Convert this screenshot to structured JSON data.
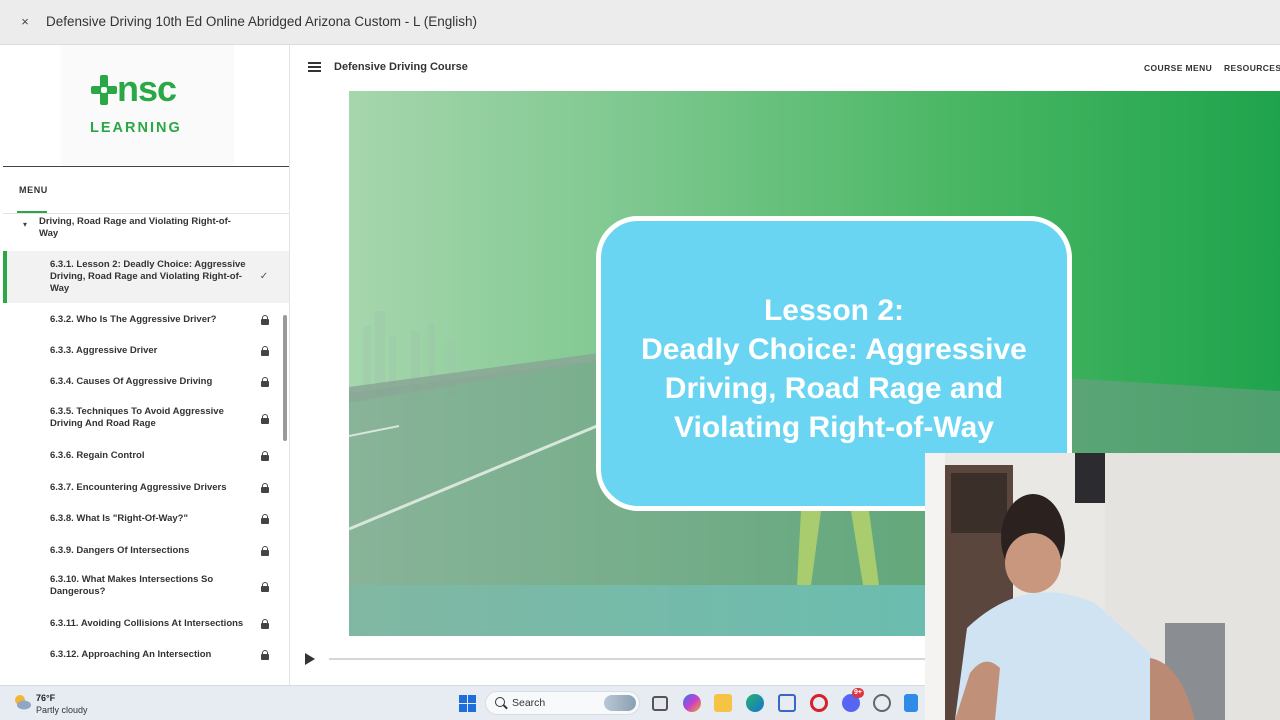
{
  "window": {
    "title": "Defensive Driving 10th Ed Online Abridged Arizona Custom - L (English)",
    "close_glyph": "×"
  },
  "brand": {
    "logo_word": "nsc",
    "logo_sub": "LEARNING",
    "color": "#2aa845"
  },
  "sidebar": {
    "menu_label": "MENU",
    "parent_item": "Driving, Road Rage and Violating Right-of-Way",
    "lessons": [
      {
        "label": "6.3.1. Lesson 2: Deadly Choice: Aggressive Driving, Road Rage and Violating Right-of-Way",
        "state": "completed",
        "icon": "checkmark-icon",
        "glyph": "✓"
      },
      {
        "label": "6.3.2. Who Is The Aggressive Driver?",
        "state": "locked",
        "icon": "lock-icon"
      },
      {
        "label": "6.3.3. Aggressive Driver",
        "state": "locked",
        "icon": "lock-icon"
      },
      {
        "label": "6.3.4. Causes Of Aggressive Driving",
        "state": "locked",
        "icon": "lock-icon"
      },
      {
        "label": "6.3.5. Techniques To Avoid Aggressive Driving And Road Rage",
        "state": "locked",
        "icon": "lock-icon"
      },
      {
        "label": "6.3.6. Regain Control",
        "state": "locked",
        "icon": "lock-icon"
      },
      {
        "label": "6.3.7. Encountering Aggressive Drivers",
        "state": "locked",
        "icon": "lock-icon"
      },
      {
        "label": "6.3.8. What Is \"Right-Of-Way?\"",
        "state": "locked",
        "icon": "lock-icon"
      },
      {
        "label": "6.3.9. Dangers Of Intersections",
        "state": "locked",
        "icon": "lock-icon"
      },
      {
        "label": "6.3.10. What Makes Intersections So Dangerous?",
        "state": "locked",
        "icon": "lock-icon"
      },
      {
        "label": "6.3.11. Avoiding Collisions At Intersections",
        "state": "locked",
        "icon": "lock-icon"
      },
      {
        "label": "6.3.12. Approaching An Intersection",
        "state": "locked",
        "icon": "lock-icon"
      }
    ]
  },
  "header": {
    "course_title": "Defensive Driving Course",
    "course_menu": "COURSE MENU",
    "resources": "RESOURCES"
  },
  "slide": {
    "title_lines": [
      "Lesson 2:",
      "Deadly Choice: Aggressive",
      "Driving, Road Rage and",
      "Violating Right-of-Way"
    ],
    "card_color": "#6ad5f2"
  },
  "player": {
    "progress_fraction": 0.0
  },
  "taskbar": {
    "weather_temp": "76°F",
    "weather_desc": "Partly cloudy",
    "search_placeholder": "Search",
    "apps": [
      "task-view-icon",
      "copilot-icon",
      "file-explorer-icon",
      "edge-icon",
      "store-icon",
      "opera-icon",
      "discord-icon",
      "app-icon",
      "notepad-icon"
    ],
    "discord_badge": "9+"
  }
}
